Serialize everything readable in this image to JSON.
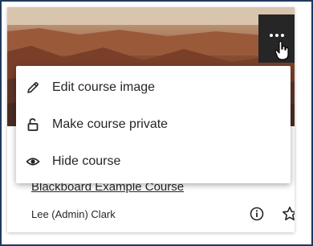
{
  "course_card": {
    "title": "Blackboard Example Course",
    "instructor": "Lee (Admin) Clark"
  },
  "menu": {
    "items": [
      {
        "label": "Edit course image",
        "icon": "pencil-icon"
      },
      {
        "label": "Make course private",
        "icon": "unlock-icon"
      },
      {
        "label": "Hide course",
        "icon": "eye-icon"
      }
    ]
  },
  "colors": {
    "frame_border": "#1f3a5c",
    "more_button_bg": "#262626",
    "text": "#262626"
  },
  "icons": {
    "more": "more-options-icon",
    "info": "info-icon",
    "favorite": "star-icon",
    "cursor": "hand-cursor-icon"
  }
}
